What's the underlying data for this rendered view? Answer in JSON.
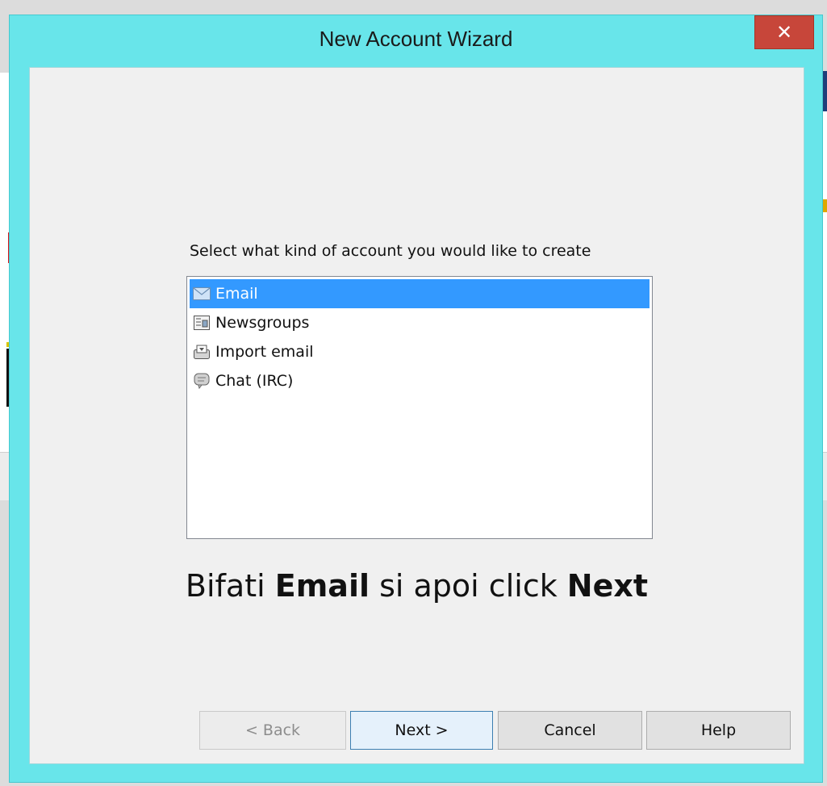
{
  "window": {
    "title": "New Account Wizard",
    "close_glyph": "✕"
  },
  "wizard": {
    "prompt": "Select what kind of account you would like to create",
    "account_types": [
      {
        "label": "Email",
        "icon": "envelope-icon",
        "selected": true
      },
      {
        "label": "Newsgroups",
        "icon": "newspaper-icon",
        "selected": false
      },
      {
        "label": "Import email",
        "icon": "inbox-tray-icon",
        "selected": false
      },
      {
        "label": "Chat (IRC)",
        "icon": "chat-bubble-icon",
        "selected": false
      }
    ],
    "instruction": {
      "part1": "Bifati ",
      "bold1": "Email",
      "part2": " si apoi click ",
      "bold2": "Next"
    }
  },
  "buttons": {
    "back": "< Back",
    "next": "Next >",
    "cancel": "Cancel",
    "help": "Help"
  },
  "colors": {
    "window_frame": "#68e5ea",
    "close_button": "#c7463a",
    "selection": "#3399ff"
  }
}
